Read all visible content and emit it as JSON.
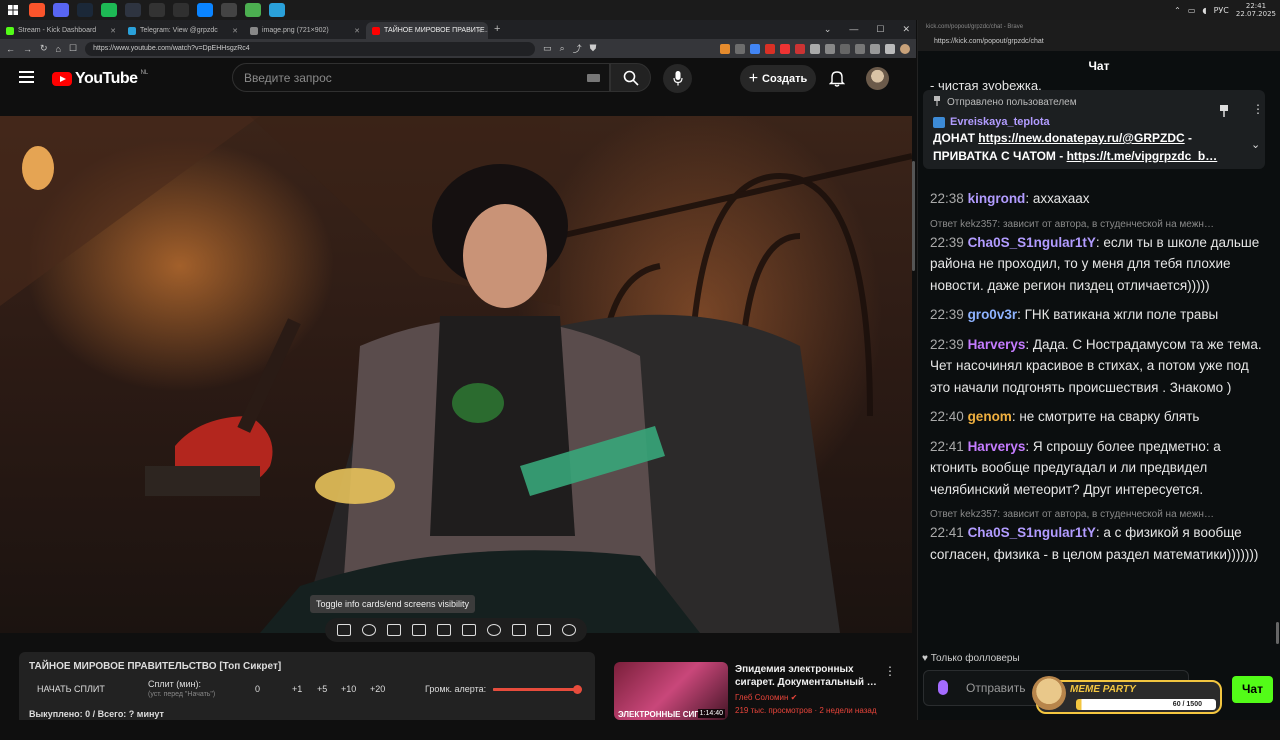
{
  "taskbar": {
    "apps": [
      {
        "name": "start-icon",
        "color": "#1b1b1b"
      },
      {
        "name": "brave-icon",
        "color": "#fb542b"
      },
      {
        "name": "discord-icon",
        "color": "#5865f2"
      },
      {
        "name": "steam-icon",
        "color": "#1b2838"
      },
      {
        "name": "spotify-icon",
        "color": "#1db954"
      },
      {
        "name": "monitor-icon",
        "color": "#2e3440"
      },
      {
        "name": "capcut-icon",
        "color": "#333333"
      },
      {
        "name": "obs-icon",
        "color": "#303030"
      },
      {
        "name": "edge-icon",
        "color": "#0a84ff"
      },
      {
        "name": "explorer-icon",
        "color": "#444444"
      },
      {
        "name": "app-icon",
        "color": "#4caf50"
      },
      {
        "name": "telegram-icon",
        "color": "#2aa1da"
      }
    ],
    "lang": "РУС",
    "time": "22:41",
    "date": "22.07.2025"
  },
  "browser": {
    "tabs": [
      {
        "label": "Stream - Kick Dashboard",
        "color": "#53fc18"
      },
      {
        "label": "Telegram: View @grpzdc",
        "color": "#2aa1da"
      },
      {
        "label": "image.png (721×902)",
        "color": "#888888"
      },
      {
        "label": "ТАЙНОЕ МИРОВОЕ ПРАВИТЕ…",
        "color": "#ff0000"
      }
    ],
    "url": "https://www.youtube.com/watch?v=DpEHHsgzRc4"
  },
  "youtube": {
    "logo": "YouTube",
    "country": "NL",
    "search_placeholder": "Введите запрос",
    "create_label": "Создать",
    "tooltip": "Toggle info cards/end screens visibility"
  },
  "extension": {
    "title": "ТАЙНОЕ МИРОВОЕ ПРАВИТЕЛЬСТВО [Топ Сикрет]",
    "start_split": "НАЧАТЬ СПЛИТ",
    "split_label": "Сплит (мин):",
    "split_sub": "(уст. перед \"Начать\")",
    "split_value": "0",
    "increments": [
      "+1",
      "+5",
      "+10",
      "+20"
    ],
    "volume_label": "Громк. алерта:",
    "volume_level": 0.96,
    "bought": "Выкуплено: 0 / Всего: ? минут"
  },
  "recommendation": {
    "title": "Эпидемия электронных сигарет. Документальный …",
    "channel": "Глеб Соломин",
    "meta": "219 тыс. просмотров · 2 недели назад",
    "duration": "1:14:40",
    "thumb_text": "ЭЛЕКТРОННЫЕ СИГ"
  },
  "chat": {
    "window_title": "kick.com/popout/grpzdc/chat - Brave",
    "url": "https://kick.com/popout/grpzdc/chat",
    "header": "Чат",
    "partial_top": "- чистая зvobежка.",
    "pinned": {
      "by": "Отправлено пользователем",
      "user": "Evreiskaya_teplota",
      "line1_prefix": "ДОНАТ ",
      "line1_link": "https://new.donatepay.ru/@GRPZDC",
      "line1_suffix": " -",
      "line2_prefix": "ПРИВАТКА С ЧАТОМ - ",
      "line2_link": "https://t.me/vipgrpzdc_b…"
    },
    "messages": [
      {
        "reply": "",
        "time": "22:38",
        "user": "kingrond",
        "color": "#b29cff",
        "text": "аххахаах"
      },
      {
        "reply": "Ответ kekz357: зависит от автора, в студенческой на межн…",
        "time": "22:39",
        "user": "Cha0S_S1ngular1tY",
        "color": "#b29cff",
        "text": "если ты в школе дальше района не проходил, то у меня для тебя плохие новости. даже регион пиздец отличается)))))"
      },
      {
        "reply": "",
        "time": "22:39",
        "user": "gro0v3r",
        "color": "#8fb3ff",
        "text": "ГНК ватикана жгли поле травы"
      },
      {
        "reply": "",
        "time": "22:39",
        "user": "Harverys",
        "color": "#c57cff",
        "text": "Дада. С Нострадамусом та же тема. Чет насочинял красивое в стихах, а потом уже под это начали подгонять происшествия . Знакомо )"
      },
      {
        "reply": "",
        "time": "22:40",
        "user": "genom",
        "color": "#f0b040",
        "text": "не смотрите на сварку блять"
      },
      {
        "reply": "",
        "time": "22:41",
        "user": "Harverys",
        "color": "#c57cff",
        "text": "Я спрошу более предметно: а ктонить вообще предугадал и ли предвидел челябинский метеорит? Друг интересуется."
      },
      {
        "reply": "Ответ kekz357: зависит от автора, в студенческой на межн…",
        "time": "22:41",
        "user": "Cha0S_S1ngular1tY",
        "color": "#b29cff",
        "text": "а с физикой я вообще согласен, физика - в целом раздел математики)))))))"
      }
    ],
    "followers_only": "Только фолловеры",
    "input_placeholder": "Отправить",
    "send_label": "Чат",
    "meme_party": {
      "label": "MEME PARTY",
      "progress_text": "60 / 1500",
      "progress": 0.04
    }
  }
}
